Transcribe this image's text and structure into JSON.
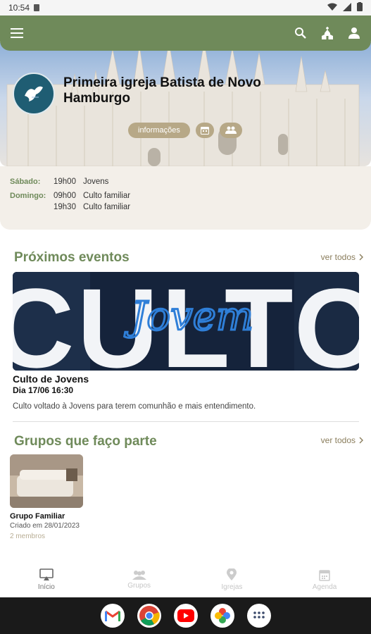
{
  "status_bar": {
    "time": "10:54"
  },
  "church": {
    "name": "Primeira igreja Batista de Novo Hamburgo",
    "info_button": "informações"
  },
  "schedule": [
    {
      "day": "Sábado:",
      "items": [
        {
          "time": "19h00",
          "label": "Jovens"
        }
      ]
    },
    {
      "day": "Domingo:",
      "items": [
        {
          "time": "09h00",
          "label": "Culto familiar"
        },
        {
          "time": "19h30",
          "label": "Culto familiar"
        }
      ]
    }
  ],
  "events": {
    "title": "Próximos eventos",
    "see_all": "ver todos",
    "banner_text_big": "CULTO",
    "banner_text_script": "Jovem",
    "item": {
      "title": "Culto de Jovens",
      "date": "Dia 17/06 16:30",
      "description": "Culto voltado à Jovens para terem comunhão e mais entendimento."
    }
  },
  "groups": {
    "title": "Grupos que faço parte",
    "see_all": "ver todos",
    "item": {
      "name": "Grupo Familiar",
      "created": "Criado em 28/01/2023",
      "members": "2 membros"
    }
  },
  "bottom_nav": [
    {
      "label": "Início",
      "icon": "home-icon",
      "active": true
    },
    {
      "label": "Grupos",
      "icon": "groups-icon",
      "active": false
    },
    {
      "label": "Igrejas",
      "icon": "location-pin-icon",
      "active": false
    },
    {
      "label": "Agenda",
      "icon": "calendar-icon",
      "active": false
    }
  ],
  "colors": {
    "primary": "#6f8a5a",
    "accent": "#b7a887",
    "schedule_bg": "#f3efe9"
  }
}
